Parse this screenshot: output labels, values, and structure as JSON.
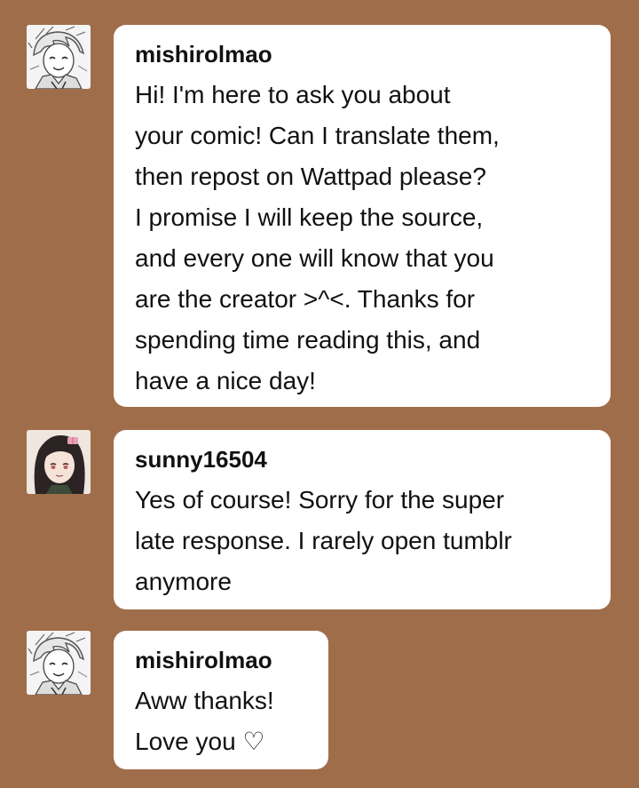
{
  "messages": [
    {
      "username": "mishirolmao",
      "avatar_icon": "anime-boy-sketch-avatar-icon",
      "text": "Hi! I'm here to ask you about\nyour comic! Can I translate them,\nthen repost on Wattpad please?\nI promise I will keep the source,\nand every one will know that you\nare the creator >^<. Thanks for\nspending time reading this, and\nhave a nice day!"
    },
    {
      "username": "sunny16504",
      "avatar_icon": "anime-girl-avatar-icon",
      "text": "Yes of course! Sorry for the super\nlate response. I rarely open tumblr\nanymore"
    },
    {
      "username": "mishirolmao",
      "avatar_icon": "anime-boy-sketch-avatar-icon",
      "text": "Aww thanks!\nLove you ♡"
    }
  ],
  "colors": {
    "background": "#a06d4a",
    "bubble": "#ffffff",
    "text": "#111111"
  }
}
